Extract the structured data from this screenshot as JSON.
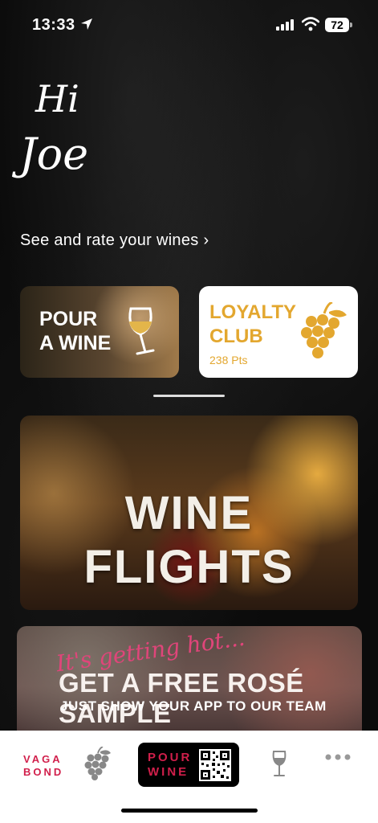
{
  "status_bar": {
    "time": "13:33",
    "battery": "72"
  },
  "greeting": {
    "hi": "Hi",
    "name": "Joe"
  },
  "rate_link": "See and rate your wines ›",
  "cards": {
    "pour": {
      "line1": "POUR",
      "line2": "A WINE"
    },
    "loyalty": {
      "line1": "LOYALTY",
      "line2": "CLUB",
      "points": "238 Pts"
    }
  },
  "flights": {
    "title": "WINE FLIGHTS"
  },
  "promo": {
    "script": "It's getting hot...",
    "title": "GET A FREE ROSÉ SAMPLE",
    "subtitle": "JUST SHOW YOUR APP TO OUR TEAM"
  },
  "tabbar": {
    "brand_line1": "VAGA",
    "brand_line2": "BOND",
    "pour_line1": "POUR",
    "pour_line2": "WINE"
  },
  "colors": {
    "accent_red": "#d11f4b",
    "loyalty_gold": "#e3a72f"
  },
  "icons": [
    "location-arrow-icon",
    "signal-icon",
    "wifi-icon",
    "wine-glass-icon",
    "grapes-icon",
    "qr-code-icon",
    "more-icon"
  ]
}
